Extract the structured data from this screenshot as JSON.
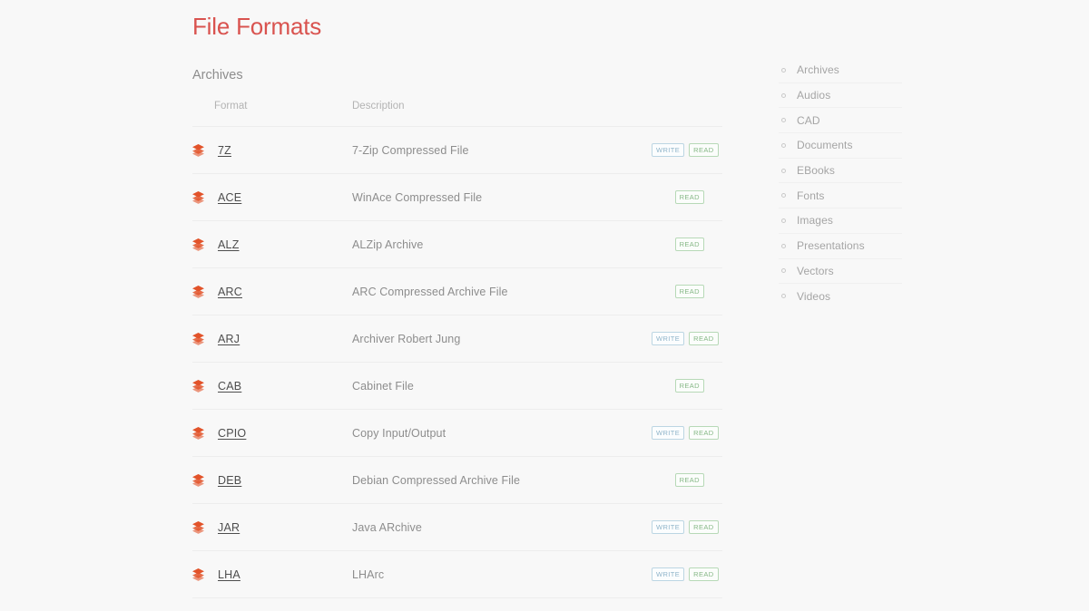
{
  "page": {
    "title": "File Formats",
    "section_heading": "Archives",
    "accent_color": "#d9534f",
    "background_color": "#f8f8f8",
    "icon_color": "#e2532a"
  },
  "table": {
    "columns": {
      "format": "Format",
      "description": "Description",
      "flags": ""
    },
    "row_icon": "layers-icon",
    "badges": {
      "write": "WRITE",
      "read": "READ",
      "write_color": "#8fb4c9",
      "read_color": "#86b886"
    },
    "rows": [
      {
        "format": "7Z",
        "description": "7-Zip Compressed File",
        "write": true,
        "read": true
      },
      {
        "format": "ACE",
        "description": "WinAce Compressed File",
        "write": false,
        "read": true
      },
      {
        "format": "ALZ",
        "description": "ALZip Archive",
        "write": false,
        "read": true
      },
      {
        "format": "ARC",
        "description": "ARC Compressed Archive File",
        "write": false,
        "read": true
      },
      {
        "format": "ARJ",
        "description": "Archiver Robert Jung",
        "write": true,
        "read": true
      },
      {
        "format": "CAB",
        "description": "Cabinet File",
        "write": false,
        "read": true
      },
      {
        "format": "CPIO",
        "description": "Copy Input/Output",
        "write": true,
        "read": true
      },
      {
        "format": "DEB",
        "description": "Debian Compressed Archive File",
        "write": false,
        "read": true
      },
      {
        "format": "JAR",
        "description": "Java ARchive",
        "write": true,
        "read": true
      },
      {
        "format": "LHA",
        "description": "LHArc",
        "write": true,
        "read": true
      }
    ]
  },
  "sidebar": {
    "items": [
      {
        "label": "Archives"
      },
      {
        "label": "Audios"
      },
      {
        "label": "CAD"
      },
      {
        "label": "Documents"
      },
      {
        "label": "EBooks"
      },
      {
        "label": "Fonts"
      },
      {
        "label": "Images"
      },
      {
        "label": "Presentations"
      },
      {
        "label": "Vectors"
      },
      {
        "label": "Videos"
      }
    ]
  }
}
